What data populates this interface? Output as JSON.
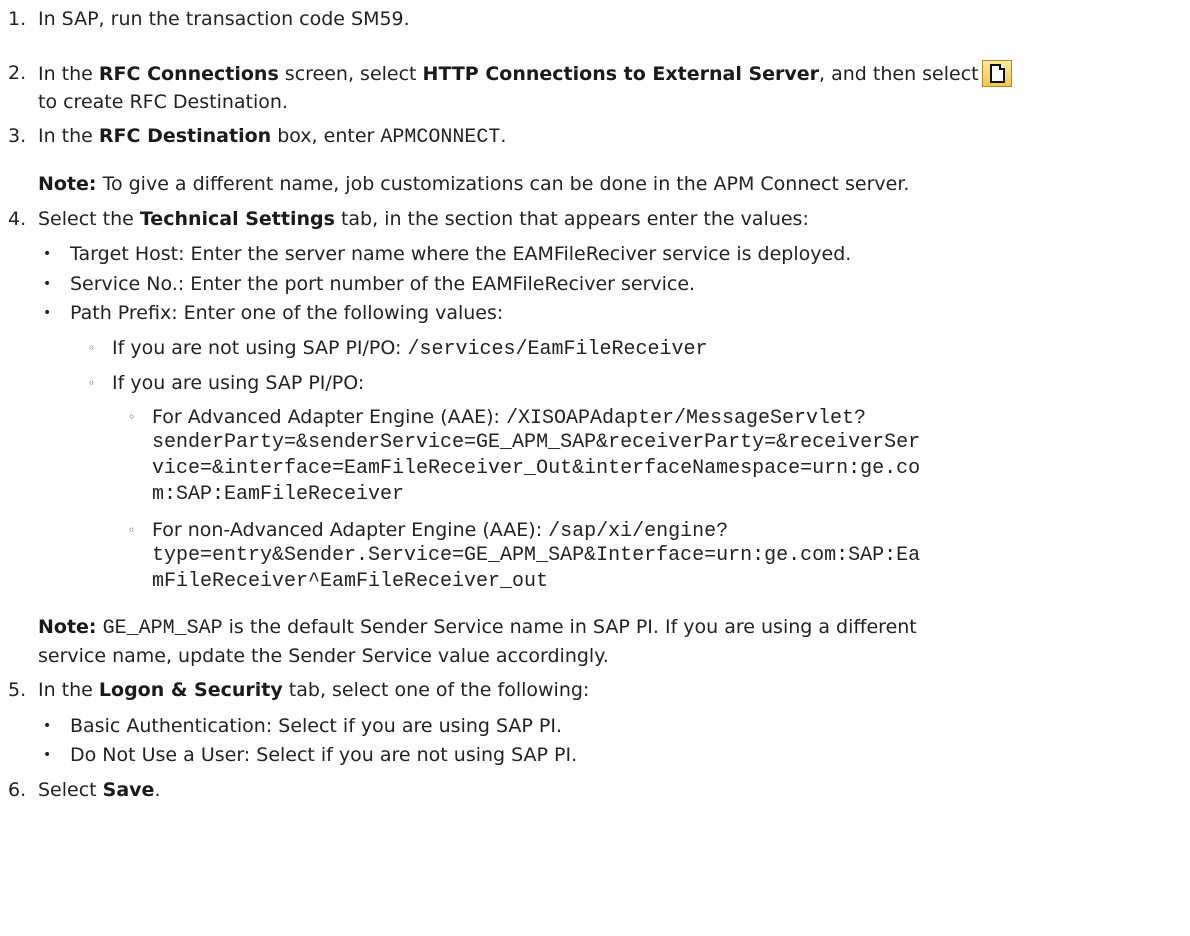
{
  "steps": {
    "s1": {
      "num": "1.",
      "text": "In SAP, run the transaction code SM59."
    },
    "s2": {
      "num": "2.",
      "a": "In the ",
      "b1": "RFC Connections",
      "c": " screen, select ",
      "b2": "HTTP Connections to External Server",
      "d": ", and then select",
      "icon": "new-document-icon",
      "line2": "to create RFC Destination."
    },
    "s3": {
      "num": "3.",
      "a": "In the ",
      "b1": "RFC Destination",
      "c": " box, enter ",
      "code": "APMCONNECT",
      "d": ".",
      "note_label": "Note:",
      "note_text": " To give a different name, job customizations can be done in the APM Connect server."
    },
    "s4": {
      "num": "4.",
      "a": "Select the ",
      "b1": "Technical Settings",
      "c": " tab, in the section that appears enter the values:",
      "bullets": [
        "Target Host: Enter the server name where the EAMFileReciver service is deployed.",
        "Service No.: Enter the port number of the EAMFileReciver service.",
        "Path Prefix: Enter one of the following values:"
      ],
      "sub1_text": "If you are not using SAP PI/PO: ",
      "sub1_code": "/services/EamFileReceiver",
      "sub2_text": "If you are using SAP PI/PO:",
      "aae_text": "For Advanced Adapter Engine (AAE): ",
      "aae_code": [
        "/XISOAPAdapter/MessageServlet?",
        "senderParty=&senderService=GE_APM_SAP&receiverParty=&receiverSer",
        "vice=&interface=EamFileReceiver_Out&interfaceNamespace=urn:ge.co",
        "m:SAP:EamFileReceiver"
      ],
      "nonaae_text": "For non-Advanced Adapter Engine (AAE): ",
      "nonaae_code": [
        "/sap/xi/engine?",
        "type=entry&Sender.Service=GE_APM_SAP&Interface=urn:ge.com:SAP:Ea",
        "mFileReceiver^EamFileReceiver_out"
      ],
      "note_label": "Note:",
      "note_code": "GE_APM_SAP",
      "note_text": " is the default Sender Service name in SAP PI. If you are using a different",
      "note_line2": "service name, update the Sender Service value accordingly."
    },
    "s5": {
      "num": "5.",
      "a": "In the ",
      "b1": "Logon & Security",
      "c": " tab, select one of the following:",
      "bullets": [
        "Basic Authentication: Select if you are using SAP PI.",
        "Do Not Use a User: Select if you are not using SAP PI."
      ]
    },
    "s6": {
      "num": "6.",
      "a": "Select ",
      "b1": "Save",
      "c": "."
    }
  }
}
